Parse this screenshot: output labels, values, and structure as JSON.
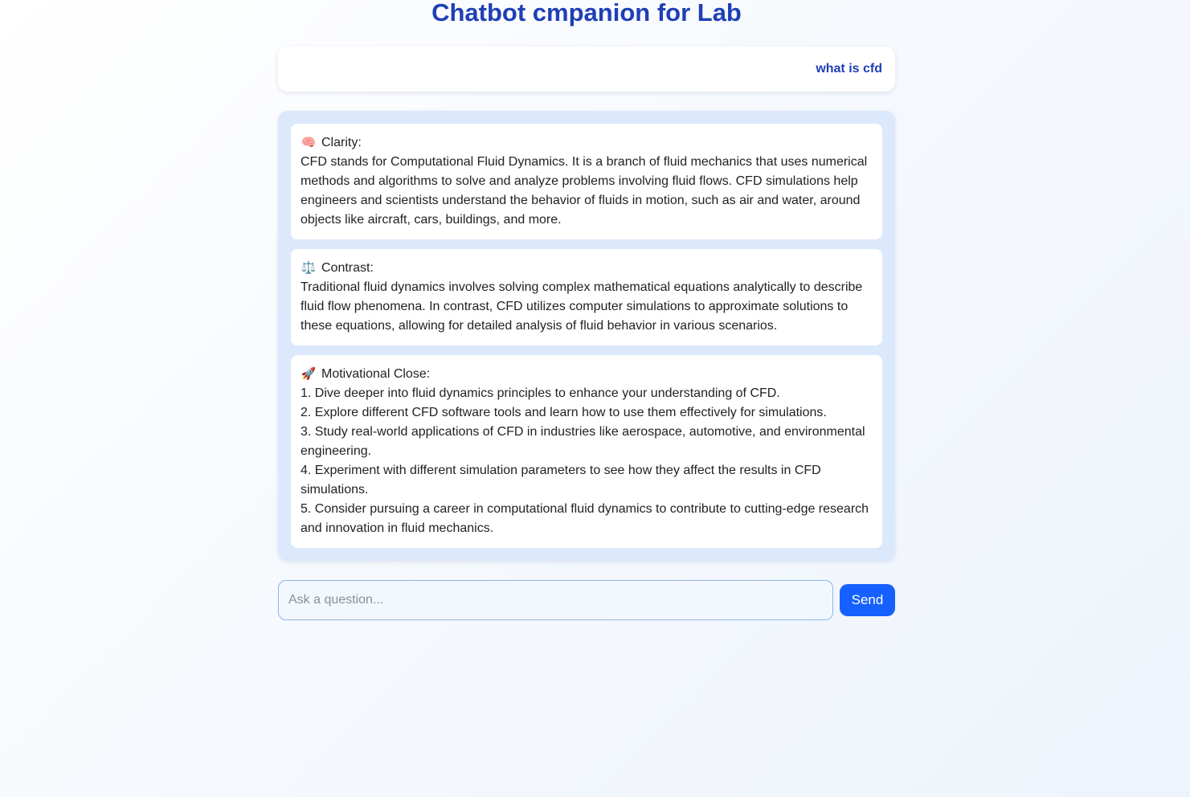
{
  "page": {
    "title": "Chatbot cmpanion for Lab"
  },
  "conversation": {
    "user_message": "what is cfd",
    "sections": [
      {
        "icon": "brain-icon",
        "glyph": "🧠",
        "heading": "Clarity:",
        "lines": [
          "CFD stands for Computational Fluid Dynamics. It is a branch of fluid mechanics that uses numerical methods and algorithms to solve and analyze problems involving fluid flows. CFD simulations help engineers and scientists understand the behavior of fluids in motion, such as air and water, around objects like aircraft, cars, buildings, and more."
        ]
      },
      {
        "icon": "balance-scale-icon",
        "glyph": "⚖️",
        "heading": "Contrast:",
        "lines": [
          "Traditional fluid dynamics involves solving complex mathematical equations analytically to describe fluid flow phenomena. In contrast, CFD utilizes computer simulations to approximate solutions to these equations, allowing for detailed analysis of fluid behavior in various scenarios."
        ]
      },
      {
        "icon": "rocket-icon",
        "glyph": "🚀",
        "heading": "Motivational Close:",
        "lines": [
          "1. Dive deeper into fluid dynamics principles to enhance your understanding of CFD.",
          "2. Explore different CFD software tools and learn how to use them effectively for simulations.",
          "3. Study real-world applications of CFD in industries like aerospace, automotive, and environmental engineering.",
          "4. Experiment with different simulation parameters to see how they affect the results in CFD simulations.",
          "5. Consider pursuing a career in computational fluid dynamics to contribute to cutting-edge research and innovation in fluid mechanics."
        ]
      }
    ]
  },
  "composer": {
    "placeholder": "Ask a question...",
    "value": "",
    "send_label": "Send"
  },
  "colors": {
    "title": "#1f3fb5",
    "user_text": "#1f3fb5",
    "bot_panel": "#dce8fc",
    "send_button": "#1660ff"
  }
}
